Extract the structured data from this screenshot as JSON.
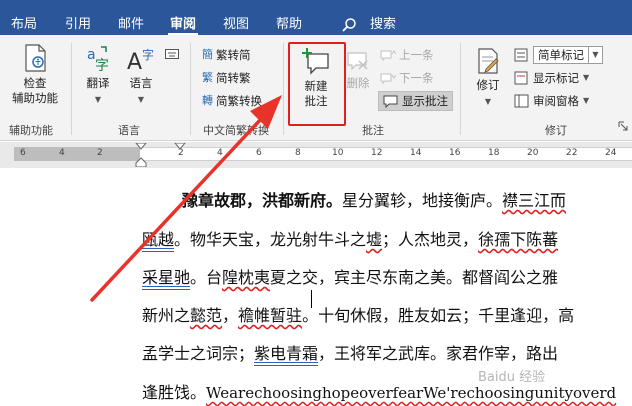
{
  "tabs": [
    {
      "label": "布局",
      "active": false
    },
    {
      "label": "引用",
      "active": false
    },
    {
      "label": "邮件",
      "active": false
    },
    {
      "label": "审阅",
      "active": true
    },
    {
      "label": "视图",
      "active": false
    },
    {
      "label": "帮助",
      "active": false
    }
  ],
  "search_label": "搜索",
  "ribbon": {
    "proofing": {
      "check_label": "检查\n辅助功能",
      "group_label": "辅助功能"
    },
    "language": {
      "translate_label": "翻译",
      "language_label": "语言",
      "group_label": "语言"
    },
    "chinese": {
      "to_simplified": "繁转简",
      "to_traditional": "简转繁",
      "convert": "简繁转换",
      "group_label": "中文简繁转换"
    },
    "comments": {
      "new_comment": "新建\n批注",
      "delete": "删除",
      "previous": "上一条",
      "next": "下一条",
      "show_comments": "显示批注",
      "group_label": "批注"
    },
    "tracking": {
      "track_changes": "修订",
      "markup_mode": "简单标记",
      "show_markup": "显示标记",
      "reviewing_pane": "审阅窗格",
      "group_label": "修订"
    }
  },
  "ruler": {
    "numbers": [
      "6",
      "4",
      "2",
      "2",
      "4",
      "6",
      "8",
      "10",
      "12",
      "14",
      "16",
      "18",
      "20",
      "22",
      "24"
    ]
  },
  "document": {
    "line1_bold": "豫章故郡，洪都新府。",
    "line1_rest": "星分翼轸，地接衡庐。",
    "line1_wavy": "襟三江而",
    "line2_underlined": "瓯越",
    "line2_a": "。物华天宝，龙光射牛斗之",
    "line2_wavy1": "墟",
    "line2_b": "；人杰地灵，",
    "line2_wavy2": "徐孺下陈蕃",
    "line3_underlined": "采星驰",
    "line3_a": "。台",
    "line3_wavy1": "隍枕夷",
    "line3_b": "夏之交，宾主尽东南之美。都督阎公之雅",
    "line4_a": "新州之",
    "line4_wavy1": "懿范",
    "line4_b": "，",
    "line4_wavy2": "襜帷暂驻",
    "line4_c": "。十旬休假，胜友如云；千里逢迎，高",
    "line5_a": "孟学士之词宗；",
    "line5_underlined": "紫电青霜",
    "line5_b": "，王将军之武库。家君作宰，路出",
    "line6_a": "逢胜饯。",
    "line6_wavy": "WearechoosinghopeoverfearWe'rechoosingunityoverd"
  },
  "watermark": "Baidu 经验"
}
